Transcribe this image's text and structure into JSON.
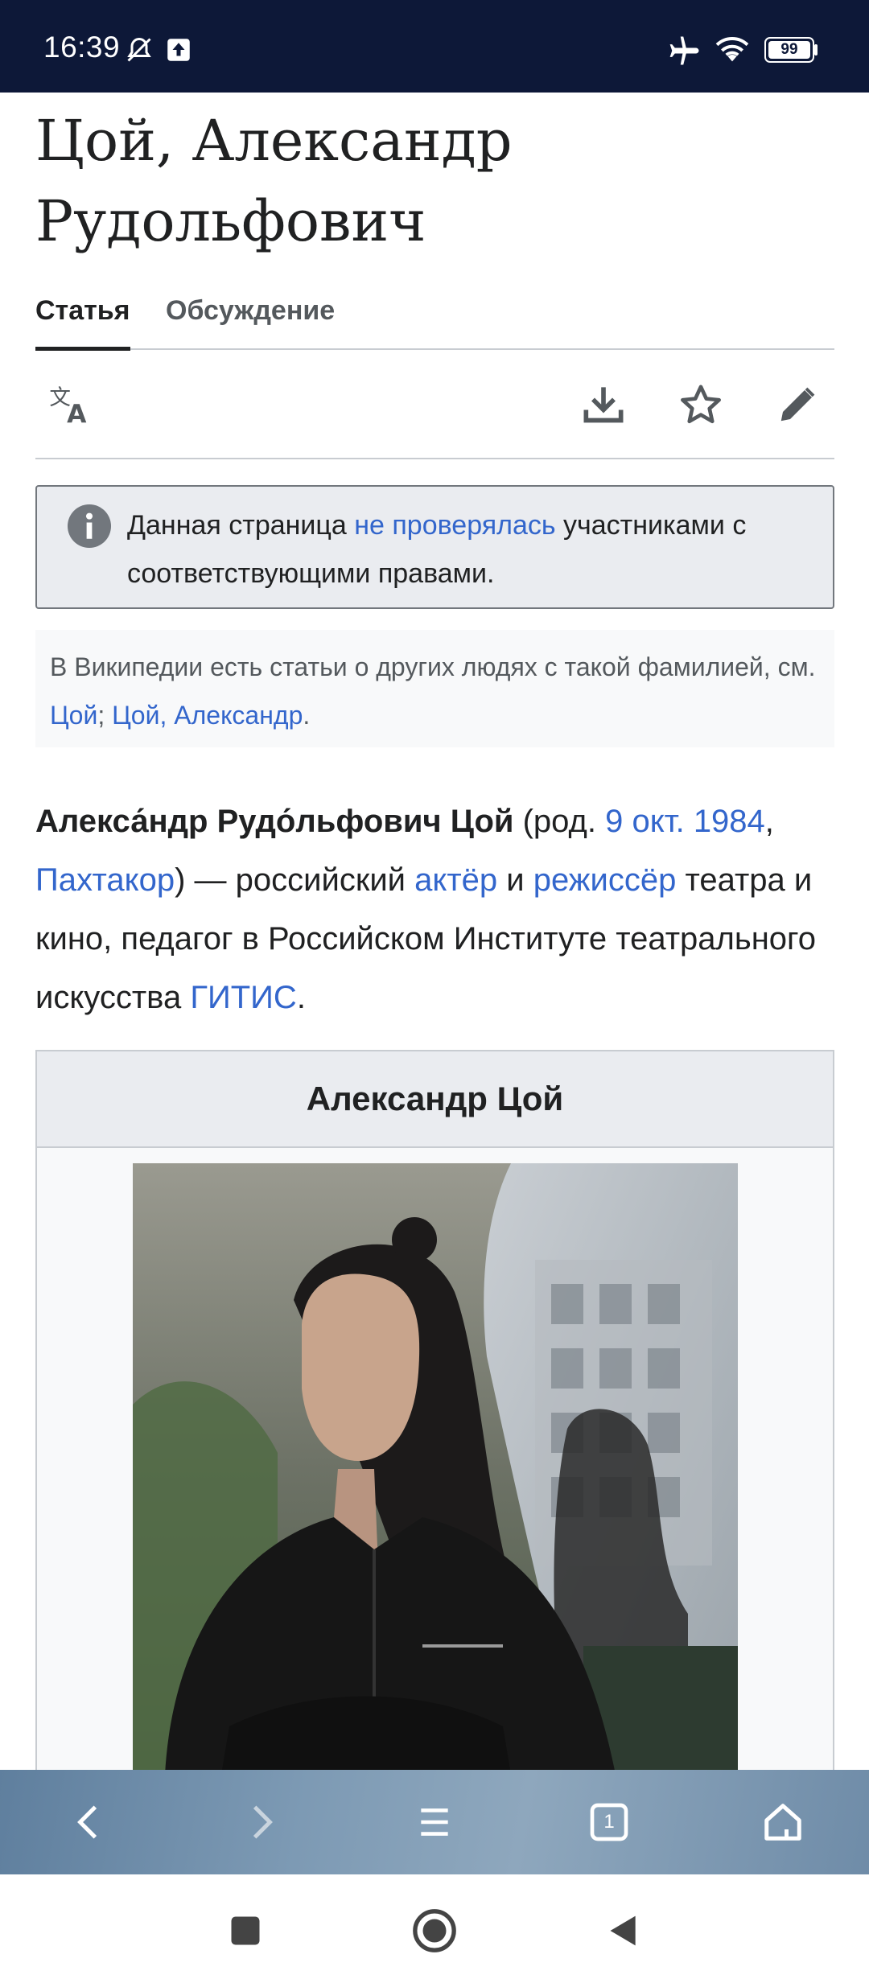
{
  "status_bar": {
    "time": "16:39",
    "battery": "99",
    "icons": [
      "mute-icon",
      "upload-icon",
      "airplane-icon",
      "wifi-icon",
      "battery-icon"
    ]
  },
  "article": {
    "title": "Цой, Александр Рудольфович",
    "tabs": [
      {
        "label": "Статья",
        "active": true
      },
      {
        "label": "Обсуждение",
        "active": false
      }
    ],
    "actions": [
      "language-icon",
      "download-icon",
      "star-icon",
      "edit-icon"
    ]
  },
  "notice": {
    "text_before": "Данная страница ",
    "link": "не проверялась",
    "text_after": " участниками с соответствующими правами."
  },
  "hatnote": {
    "text_before": "В Википедии есть статьи о других людях с такой фамилией, см. ",
    "link1": "Цой",
    "separator": "; ",
    "link2": "Цой, Александр",
    "text_after": "."
  },
  "lead": {
    "name": "Алекса́ндр Рудо́льфович Цой",
    "born_prefix": " (род. ",
    "date_link": "9 окт.",
    "space": " ",
    "year_link": "1984",
    "comma": ",",
    "place_link": "Пахтакор",
    "text_1": ") — российский ",
    "actor_link": "актёр",
    "and": " и ",
    "director_link": "режиссёр",
    "text_2": " театра и кино, педагог в Российском Институте театрального искусства ",
    "gitis_link": "ГИТИС",
    "end": "."
  },
  "infobox": {
    "title": "Александр Цой"
  },
  "browser_toolbar": [
    "back-icon",
    "forward-icon",
    "menu-icon",
    "tabs-icon",
    "home-icon"
  ],
  "tabs_count": "1",
  "system_nav": [
    "recents-button",
    "home-button",
    "back-button"
  ]
}
